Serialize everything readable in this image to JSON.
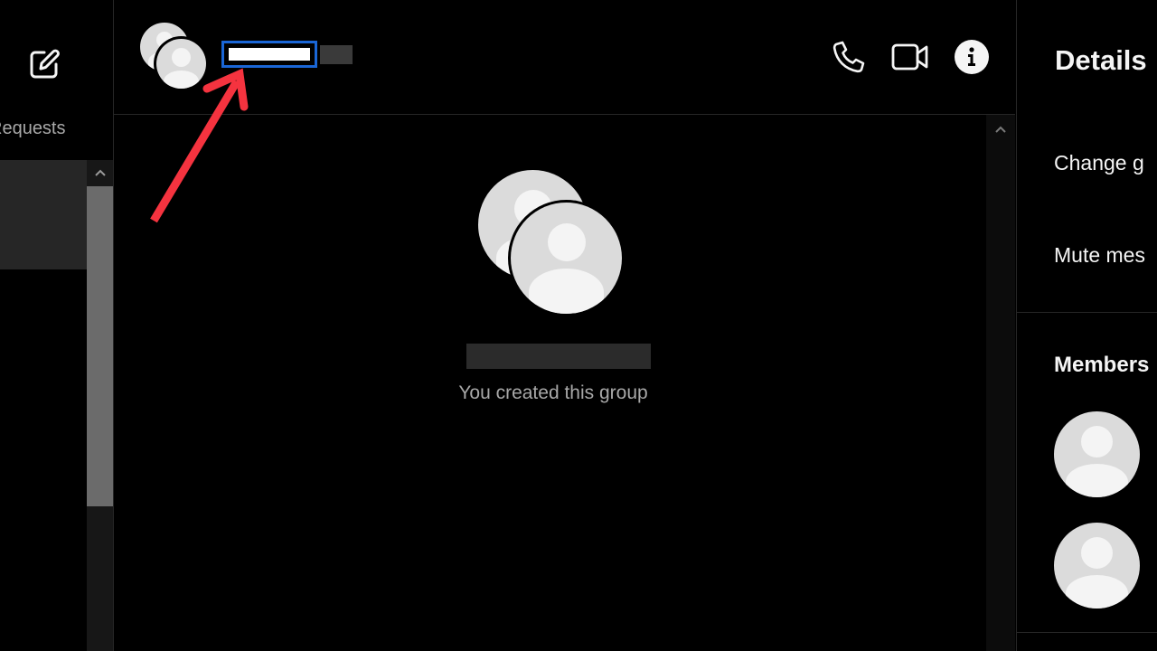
{
  "sidebar": {
    "compose_icon": "compose-icon",
    "requests_label": "Requests",
    "scroll_up_icon": "chevron-up-icon"
  },
  "header": {
    "group_name": "",
    "call_icon": "phone-icon",
    "video_icon": "video-camera-icon",
    "info_icon": "info-icon"
  },
  "chat": {
    "created_text": "You created this group",
    "scroll_up_icon": "chevron-up-icon"
  },
  "details": {
    "title": "Details",
    "items": [
      {
        "label": "Change g"
      },
      {
        "label": "Mute mes"
      }
    ],
    "members_title": "Members"
  },
  "colors": {
    "background": "#000000",
    "divider": "#262626",
    "selection_border": "#1a66d6",
    "annotation_arrow": "#f5333f",
    "avatar_bg": "#dbdbdb",
    "avatar_fg": "#f4f4f4",
    "muted_text": "#a8a8a8"
  }
}
